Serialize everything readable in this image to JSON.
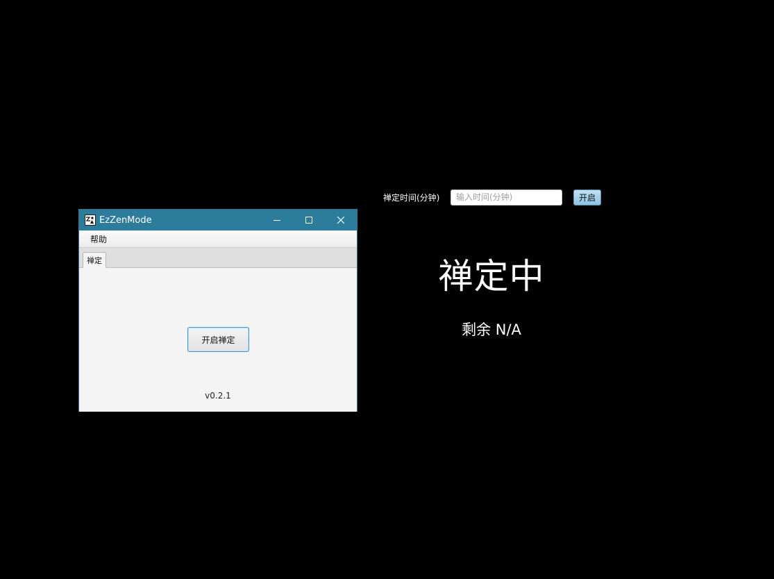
{
  "zen_overlay": {
    "duration_label": "禅定时间(分钟)",
    "duration_placeholder": "输入时间(分钟)",
    "duration_value": "",
    "start_button": "开启",
    "status_title": "禅定中",
    "remaining_text": "剩余 N/A"
  },
  "window": {
    "title": "EzZenMode",
    "icon": "app-logo-icon",
    "controls": {
      "minimize": "minimize-icon",
      "maximize": "maximize-icon",
      "close": "close-icon"
    },
    "menu": [
      {
        "label": "帮助"
      }
    ],
    "tabs": [
      {
        "label": "禅定",
        "selected": true
      }
    ],
    "start_zen_button": "开启禅定",
    "version": "v0.2.1"
  },
  "colors": {
    "background": "#000000",
    "titlebar": "#2b7d9b",
    "focus_border": "#3a9bd6"
  }
}
